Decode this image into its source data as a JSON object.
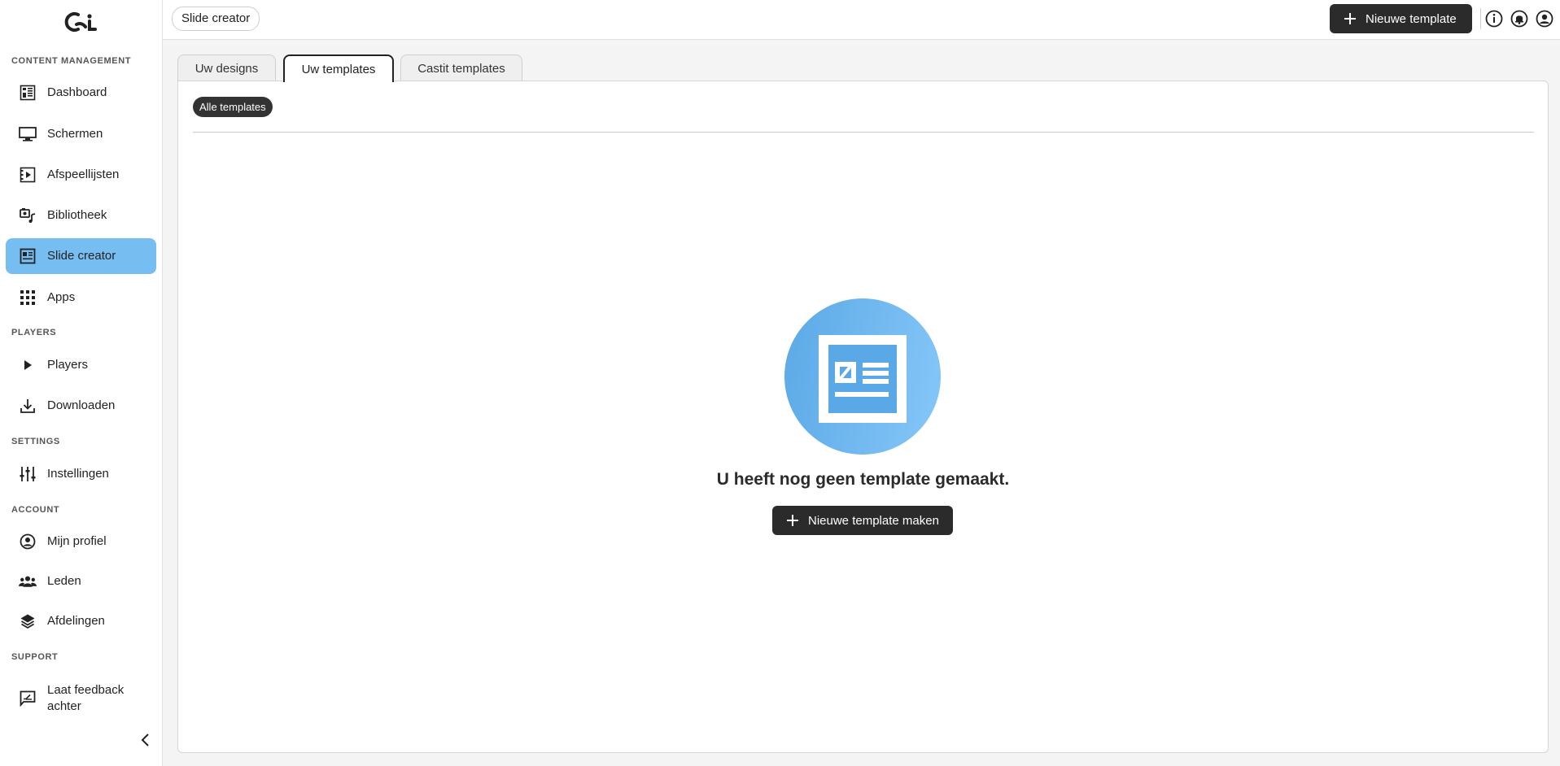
{
  "sidebar": {
    "sections": {
      "content": "CONTENT MANAGEMENT",
      "players": "PLAYERS",
      "settings": "SETTINGS",
      "account": "ACCOUNT",
      "support": "SUPPORT"
    },
    "items": [
      {
        "label": "Dashboard",
        "icon": "dashboard-icon"
      },
      {
        "label": "Schermen",
        "icon": "monitor-icon"
      },
      {
        "label": "Afspeellijsten",
        "icon": "playlist-icon"
      },
      {
        "label": "Bibliotheek",
        "icon": "library-icon"
      },
      {
        "label": "Slide creator",
        "icon": "slide-creator-icon",
        "active": true
      },
      {
        "label": "Apps",
        "icon": "apps-grid-icon"
      },
      {
        "label": "Players",
        "icon": "play-icon"
      },
      {
        "label": "Downloaden",
        "icon": "download-icon"
      },
      {
        "label": "Instellingen",
        "icon": "sliders-icon"
      },
      {
        "label": "Mijn profiel",
        "icon": "profile-icon"
      },
      {
        "label": "Leden",
        "icon": "members-icon"
      },
      {
        "label": "Afdelingen",
        "icon": "layers-icon"
      },
      {
        "label": "Laat feedback achter",
        "icon": "feedback-icon"
      }
    ]
  },
  "topbar": {
    "breadcrumb": "Slide creator",
    "new_template_label": "Nieuwe template"
  },
  "tabs": [
    {
      "label": "Uw designs"
    },
    {
      "label": "Uw templates",
      "active": true
    },
    {
      "label": "Castit templates"
    }
  ],
  "filter_chip": "Alle templates",
  "empty_state": {
    "message": "U heeft nog geen template gemaakt.",
    "button_label": "Nieuwe template maken"
  },
  "colors": {
    "accent_active": "#76bdf2",
    "button_dark": "#2b2b2b",
    "illustration_blue": "#5ba9e6"
  }
}
